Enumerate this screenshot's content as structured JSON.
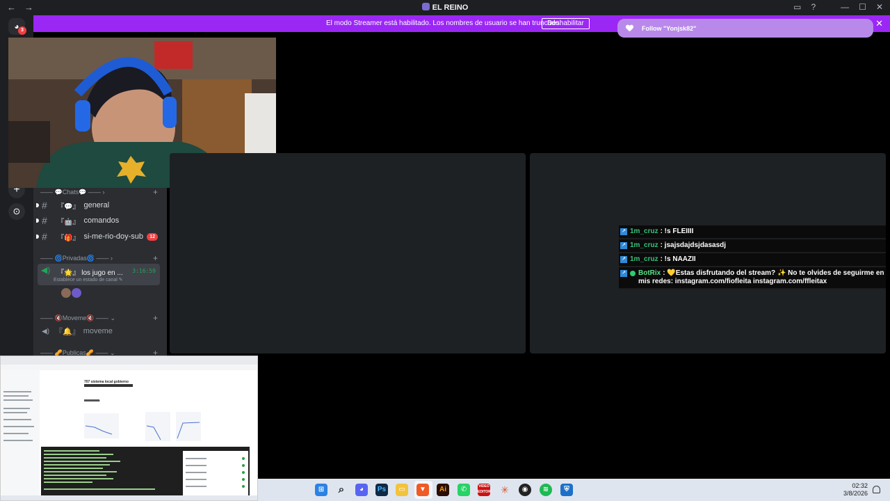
{
  "titlebar": {
    "title": "EL REINO",
    "back": "←",
    "forward": "→",
    "inbox_icon": "▭",
    "help_icon": "?",
    "minimize": "—",
    "maximize": "☐",
    "close": "✕"
  },
  "streamer_mode": {
    "message": "El modo Streamer está habilitado. Los nombres de usuario se han truncado.",
    "button": "Deshabilitar",
    "close": "✕"
  },
  "follow_alert": {
    "text": "Follow \"Yonjsk82\""
  },
  "server_rail": {
    "mention_count": "3",
    "add_server": "+",
    "discover": "⊙"
  },
  "channels": {
    "categories": {
      "chats": "—— 💬Chats💬 ——",
      "privadas": "—— 🌀Privadas🌀 ——",
      "moveme": "—— 🔇Moveme🔇 ——",
      "publicas": "—— 🥜Publicas🥜 ——"
    },
    "text_channels": [
      {
        "deco": "『💬』",
        "name": "general"
      },
      {
        "deco": "『🤖』",
        "name": "comandos"
      },
      {
        "deco": "『🎁』",
        "name": "si-me-rio-doy-sub",
        "badge": "12"
      }
    ],
    "voice_active": {
      "deco": "『🌟』",
      "name": "los jugo en ...",
      "time": "3:16:59",
      "status": "Establece un estado de canal"
    },
    "voice_moveme": {
      "deco": "『🔔』",
      "name": "moveme"
    }
  },
  "twitch_chat": [
    {
      "user": "1m_cruz",
      "text": ": !s FLEIIII"
    },
    {
      "user": "1m_cruz",
      "text": ": jsajsdajdsjdasasdj"
    },
    {
      "user": "1m_cruz",
      "text": ": !s NAAZII"
    },
    {
      "user": "BotRix",
      "text": ": 💛Estas disfrutando del stream? ✨ No te olvides de seguirme en mis redes: instagram.com/fiofleita instagram.com/ffleitax"
    }
  ],
  "screenshare": {
    "page_title": "707 sistema local gobierno",
    "section": "Consultación"
  },
  "taskbar": {
    "time": "02:32",
    "date": "3/8/2026"
  },
  "colors": {
    "streamer_bar": "#9b27f5",
    "follow_toast": "#b889ea",
    "rail": "#1e1f22",
    "channel_panel": "#2b2d31",
    "tile": "#1e2123"
  }
}
